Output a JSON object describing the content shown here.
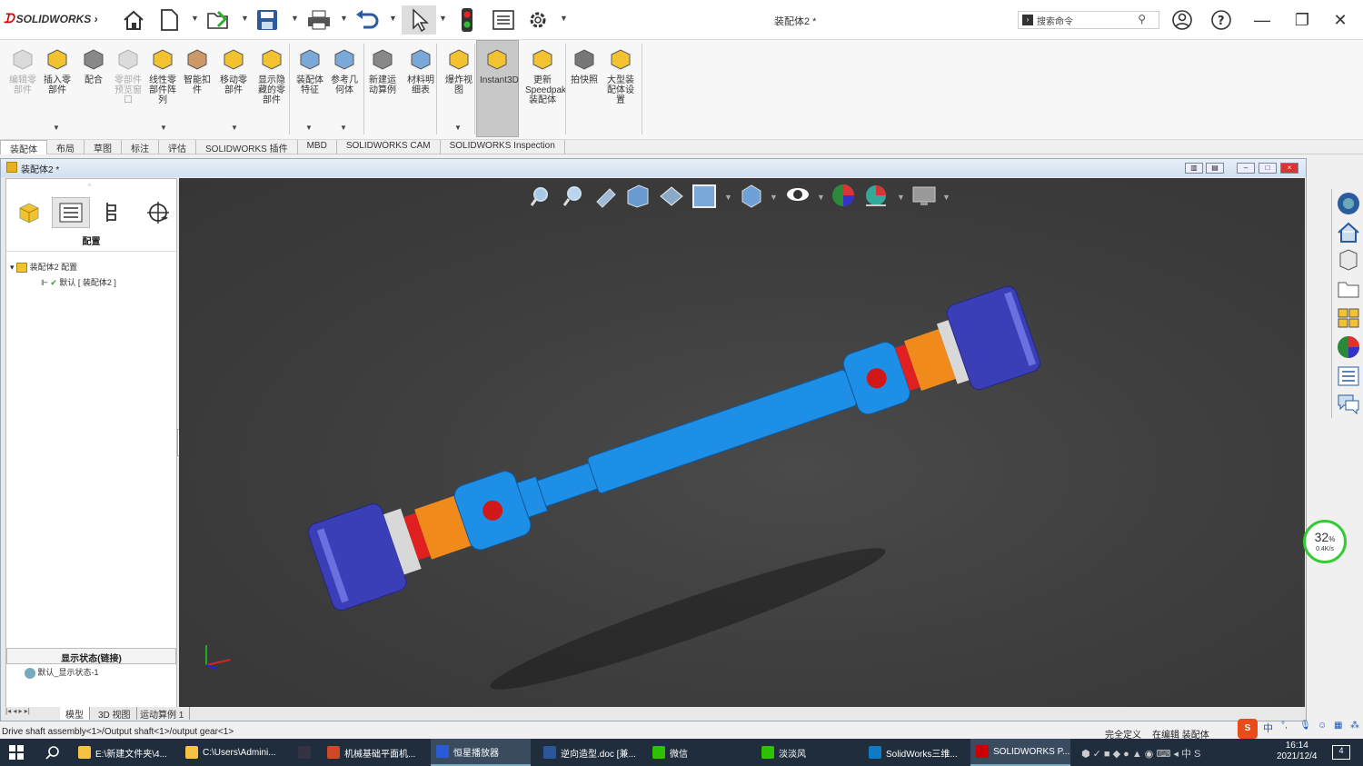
{
  "app": {
    "logo": "SOLIDWORKS",
    "document_title": "装配体2 *"
  },
  "search": {
    "placeholder": "搜索命令"
  },
  "ribbon": {
    "buttons": [
      {
        "label": "编辑零部件",
        "disabled": true
      },
      {
        "label": "插入零部件"
      },
      {
        "label": "配合"
      },
      {
        "label": "零部件预览窗口",
        "disabled": true
      },
      {
        "label": "线性零部件阵列"
      },
      {
        "label": "智能扣件"
      },
      {
        "label": "移动零部件"
      },
      {
        "label": "显示隐藏的零部件"
      },
      {
        "label": "装配体特征"
      },
      {
        "label": "参考几何体"
      },
      {
        "label": "新建运动算例"
      },
      {
        "label": "材料明细表"
      },
      {
        "label": "爆炸视图"
      },
      {
        "label": "Instant3D"
      },
      {
        "label": "更新Speedpak装配体"
      },
      {
        "label": "拍快照"
      },
      {
        "label": "大型装配体设置"
      }
    ]
  },
  "tabs": [
    "装配体",
    "布局",
    "草图",
    "标注",
    "评估",
    "SOLIDWORKS 插件",
    "MBD",
    "SOLIDWORKS CAM",
    "SOLIDWORKS Inspection"
  ],
  "doc_window": {
    "title": "装配体2 *"
  },
  "feature_manager": {
    "heading": "配置",
    "tree_root": "装配体2 配置",
    "tree_child": "默认 [ 装配体2 ]",
    "display_state_heading": "显示状态(链接)",
    "display_state_item": "默认_显示状态-1"
  },
  "bottom_tabs": [
    "模型",
    "3D 视图",
    "运动算例 1"
  ],
  "status": {
    "path": "Drive shaft assembly<1>/Output shaft<1>/output gear<1>",
    "defined": "完全定义",
    "editing": "在编辑 装配体"
  },
  "gauge": {
    "value": "32",
    "unit": "%",
    "label": "0.4K/s"
  },
  "taskbar": {
    "items": [
      {
        "label": "E:\\新建文件夹\\4..."
      },
      {
        "label": "C:\\Users\\Admini..."
      },
      {
        "label": ""
      },
      {
        "label": "机械基础平面机..."
      },
      {
        "label": "恒星播放器"
      },
      {
        "label": "逆向造型.doc [兼..."
      },
      {
        "label": "微信"
      },
      {
        "label": "淡淡风"
      },
      {
        "label": "SolidWorks三维..."
      },
      {
        "label": "SOLIDWORKS P..."
      }
    ],
    "time": "16:14",
    "date": "2021/12/4",
    "ime": "中",
    "notif": "4"
  },
  "colors": {
    "accent": "#1e8fe6",
    "viewport": "#3f3f3f",
    "taskbar": "#1f2d3d"
  }
}
